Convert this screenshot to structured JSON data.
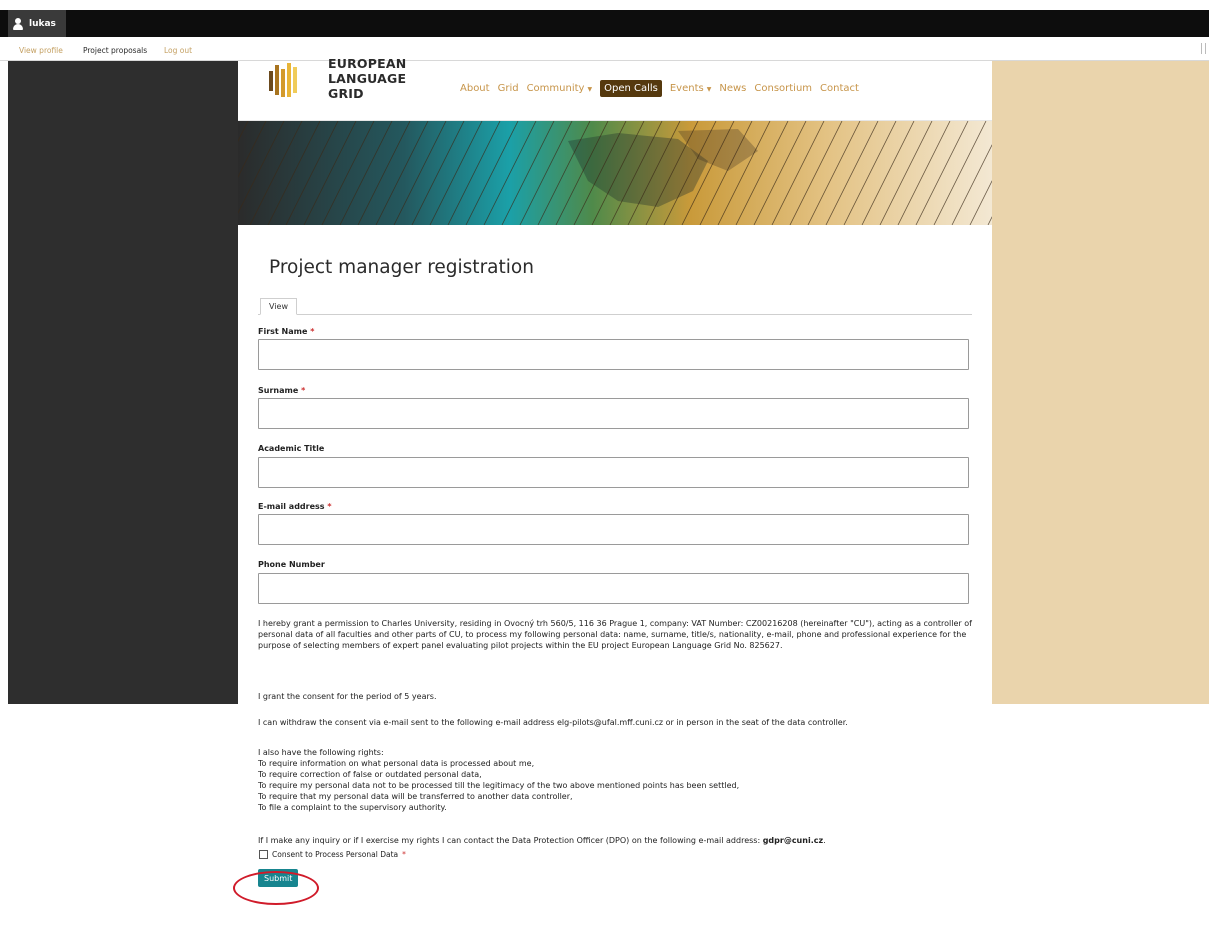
{
  "toolbar": {
    "username": "lukas",
    "links": [
      "View profile",
      "Project proposals",
      "Log out"
    ]
  },
  "site": {
    "logo_lines": [
      "EUROPEAN",
      "LANGUAGE",
      "GRID"
    ],
    "nav": {
      "about": "About",
      "grid": "Grid",
      "community": "Community",
      "open_calls": "Open Calls",
      "events": "Events",
      "news": "News",
      "consortium": "Consortium",
      "contact": "Contact"
    }
  },
  "page": {
    "title": "Project manager registration",
    "tab_view": "View"
  },
  "form": {
    "first_name": {
      "label": "First Name",
      "value": ""
    },
    "surname": {
      "label": "Surname",
      "value": ""
    },
    "academic_title": {
      "label": "Academic Title",
      "value": ""
    },
    "email": {
      "label": "E-mail address",
      "value": ""
    },
    "phone": {
      "label": "Phone Number",
      "value": ""
    },
    "required_marker": "*",
    "consent_intro": "I hereby grant a permission to Charles University, residing in Ovocný trh 560/5, 116 36 Prague 1, company: VAT Number: CZ00216208 (hereinafter \"CU\"), acting as a controller of personal data of all faculties and other parts of CU, to process my following personal data: name, surname, title/s, nationality, e-mail, phone and professional experience for the purpose of selecting members of expert panel evaluating pilot projects within the EU project European Language Grid No. 825627.",
    "consent_period": "I grant the consent for the period of 5 years.",
    "withdraw": "I can withdraw the consent via e-mail sent to the following e-mail address elg-pilots@ufal.mff.cuni.cz or in person in the seat of the data controller.",
    "rights": [
      "I also have the following rights:",
      "To require information on what personal data is processed about me,",
      "To require correction of false or outdated personal data,",
      "To require my personal data not to be processed till the legitimacy of the two above mentioned points has been settled,",
      "To require that my personal data will be transferred to another data controller,",
      "To file a complaint to the supervisory authority."
    ],
    "dpo_text": "If I make any inquiry or if I exercise my rights I can contact the Data Protection Officer (DPO) on the following e-mail address:",
    "dpo_email": "gdpr@cuni.cz",
    "dpo_end": ".",
    "checkbox_label": "Consent to Process Personal Data",
    "checkbox_checked": false,
    "submit_label": "Submit"
  },
  "colors": {
    "nav_link": "#c7954a",
    "nav_active_bg": "#55390e",
    "submit_bg": "#17858f",
    "required": "#cc2f2f",
    "annotation_ring": "#d01b2a",
    "left_bg": "#2e2e2e",
    "right_bg": "#ead4ac"
  },
  "icons": {
    "user": "user-icon",
    "caret": "caret-down-icon",
    "checkbox": "checkbox-icon"
  }
}
